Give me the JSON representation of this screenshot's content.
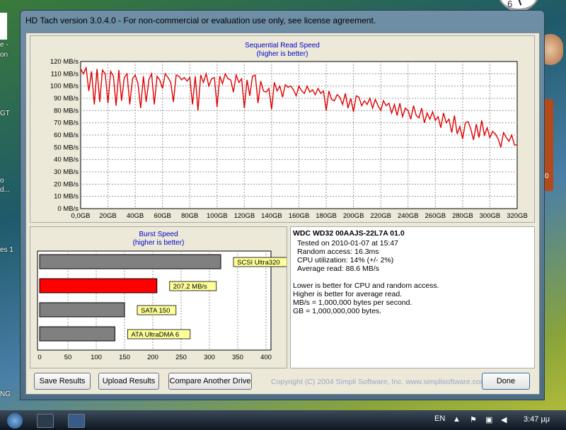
{
  "window": {
    "title": "HD Tach version 3.0.4.0  - For non-commercial or evaluation use only, see license agreement."
  },
  "seq_chart": {
    "title": "Sequential Read Speed",
    "subtitle": "(higher is better)"
  },
  "burst_chart": {
    "title": "Burst Speed",
    "subtitle": "(higher is better)"
  },
  "results": {
    "drive": "WDC WD32 00AAJS-22L7A 01.0",
    "tested": "Tested on 2010-01-07 at 15:47",
    "random_access": "Random access: 16.3ms",
    "cpu": "CPU utilization: 14% (+/- 2%)",
    "avg_read": "Average read: 88.6 MB/s",
    "note1": "Lower is better for CPU and random access.",
    "note2": "Higher is better for average read.",
    "note3": "MB/s = 1,000,000 bytes per second.",
    "note4": "GB = 1,000,000,000 bytes."
  },
  "buttons": {
    "save": "Save Results",
    "upload": "Upload Results",
    "compare": "Compare Another Drive",
    "done": "Done"
  },
  "copyright": "Copyright (C) 2004 Simpli Software, Inc. www.simplisoftware.com",
  "taskbar": {
    "lang": "EN",
    "clock": "3:47 μμ"
  },
  "desktop": {
    "clock_face": "6",
    "left_frag": [
      "e -",
      "on",
      "GT",
      "o",
      "d...",
      "es 1",
      "NG"
    ],
    "right_frag": "0"
  },
  "colors": {
    "series": "#e00000",
    "bar_gray": "#808080",
    "bar_red": "#ff0000",
    "label_bg": "#ffff99"
  },
  "chart_data": [
    {
      "type": "line",
      "title": "Sequential Read Speed",
      "subtitle": "(higher is better)",
      "xlabel": "",
      "ylabel": "",
      "x_ticks": [
        "0,0GB",
        "20GB",
        "40GB",
        "60GB",
        "80GB",
        "100GB",
        "120GB",
        "140GB",
        "160GB",
        "180GB",
        "200GB",
        "220GB",
        "240GB",
        "260GB",
        "280GB",
        "300GB",
        "320GB"
      ],
      "y_ticks": [
        "0 MB/s",
        "10 MB/s",
        "20 MB/s",
        "30 MB/s",
        "40 MB/s",
        "50 MB/s",
        "60 MB/s",
        "70 MB/s",
        "80 MB/s",
        "90 MB/s",
        "100 MB/s",
        "110 MB/s",
        "120 MB/s"
      ],
      "xlim": [
        0,
        320
      ],
      "ylim": [
        0,
        120
      ],
      "grid": true,
      "series": [
        {
          "x": [
            0,
            2,
            4,
            6,
            8,
            10,
            12,
            14,
            16,
            18,
            20,
            22,
            24,
            26,
            28,
            30,
            32,
            34,
            36,
            38,
            40,
            42,
            44,
            46,
            48,
            50,
            52,
            54,
            56,
            58,
            60,
            62,
            64,
            66,
            68,
            70,
            72,
            74,
            76,
            78,
            80,
            82,
            84,
            86,
            88,
            90,
            92,
            94,
            96,
            98,
            100,
            102,
            104,
            106,
            108,
            110,
            112,
            114,
            116,
            118,
            120,
            122,
            124,
            126,
            128,
            130,
            132,
            134,
            136,
            138,
            140,
            142,
            144,
            146,
            148,
            150,
            152,
            154,
            156,
            158,
            160,
            162,
            164,
            166,
            168,
            170,
            172,
            174,
            176,
            178,
            180,
            182,
            184,
            186,
            188,
            190,
            192,
            194,
            196,
            198,
            200,
            202,
            204,
            206,
            208,
            210,
            212,
            214,
            216,
            218,
            220,
            222,
            224,
            226,
            228,
            230,
            232,
            234,
            236,
            238,
            240,
            242,
            244,
            246,
            248,
            250,
            252,
            254,
            256,
            258,
            260,
            262,
            264,
            266,
            268,
            270,
            272,
            274,
            276,
            278,
            280,
            282,
            284,
            286,
            288,
            290,
            292,
            294,
            296,
            298,
            300,
            302,
            304,
            306,
            308,
            310,
            312,
            314,
            316,
            318,
            320
          ],
          "y": [
            114,
            110,
            115,
            96,
            112,
            85,
            114,
            87,
            113,
            110,
            86,
            112,
            108,
            84,
            113,
            88,
            107,
            110,
            85,
            106,
            109,
            102,
            82,
            108,
            87,
            105,
            110,
            85,
            108,
            105,
            98,
            110,
            107,
            103,
            87,
            109,
            108,
            105,
            107,
            104,
            107,
            85,
            108,
            80,
            109,
            103,
            110,
            100,
            106,
            107,
            83,
            108,
            102,
            110,
            106,
            105,
            95,
            109,
            103,
            106,
            82,
            105,
            92,
            108,
            109,
            86,
            104,
            96,
            95,
            98,
            81,
            103,
            96,
            100,
            91,
            101,
            99,
            100,
            97,
            92,
            100,
            96,
            94,
            100,
            95,
            97,
            93,
            98,
            94,
            96,
            80,
            96,
            89,
            88,
            93,
            91,
            85,
            94,
            82,
            90,
            79,
            92,
            91,
            84,
            88,
            85,
            90,
            82,
            89,
            84,
            80,
            88,
            84,
            86,
            78,
            85,
            76,
            86,
            75,
            82,
            80,
            73,
            84,
            76,
            74,
            82,
            70,
            78,
            73,
            79,
            72,
            75,
            66,
            78,
            70,
            73,
            62,
            76,
            61,
            67,
            57,
            70,
            71,
            65,
            56,
            69,
            58,
            72,
            60,
            66,
            58,
            63,
            61,
            57,
            50,
            62,
            58,
            55,
            60,
            52,
            52
          ]
        }
      ]
    },
    {
      "type": "bar",
      "title": "Burst Speed",
      "subtitle": "(higher is better)",
      "orientation": "horizontal",
      "categories": [
        "SCSI Ultra320",
        "207.2 MB/s",
        "SATA 150",
        "ATA UltraDMA 6"
      ],
      "values": [
        320,
        207.2,
        150,
        133
      ],
      "x_ticks": [
        "0",
        "50",
        "100",
        "150",
        "200",
        "250",
        "300",
        "350",
        "400"
      ],
      "xlim": [
        0,
        400
      ],
      "grid": true
    }
  ]
}
